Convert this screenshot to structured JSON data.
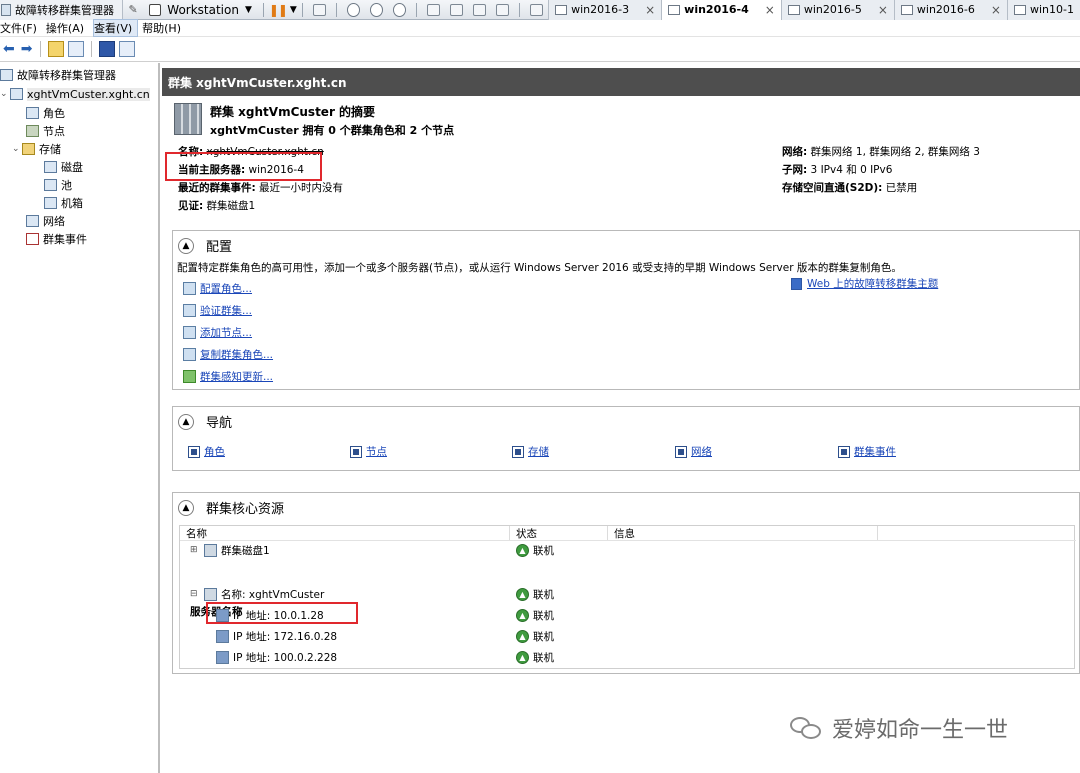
{
  "vmware": {
    "app_title": "故障转移群集管理器",
    "product": "Workstation",
    "tabs": [
      {
        "label": "win2016-3",
        "active": false
      },
      {
        "label": "win2016-4",
        "active": true
      },
      {
        "label": "win2016-5",
        "active": false
      },
      {
        "label": "win2016-6",
        "active": false
      },
      {
        "label": "win10-1",
        "active": false
      }
    ],
    "close_glyph": "×"
  },
  "menu": {
    "file": "文件(F)",
    "action": "操作(A)",
    "view": "查看(V)",
    "help": "帮助(H)"
  },
  "tree": {
    "root": "故障转移群集管理器",
    "cluster": "xghtVmCuster.xght.cn",
    "roles": "角色",
    "nodes": "节点",
    "storage": "存储",
    "disks": "磁盘",
    "pools": "池",
    "enclosures": "机箱",
    "networks": "网络",
    "events": "群集事件"
  },
  "main": {
    "header": "群集 xghtVmCuster.xght.cn",
    "summary_title": "群集 xghtVmCuster 的摘要",
    "summary_sub": "xghtVmCuster 拥有 0 个群集角色和 2 个节点",
    "name_label": "名称:",
    "name_value": "xghtVmCuster.xght.cn",
    "host_label": "当前主服务器:",
    "host_value": "win2016-4",
    "events_label": "最近的群集事件:",
    "events_value": "最近一小时内没有",
    "witness_label": "见证:",
    "witness_value": "群集磁盘1",
    "network_label": "网络:",
    "network_value": "群集网络 1, 群集网络 2, 群集网络 3",
    "subnet_label": "子网:",
    "subnet_value": "3 IPv4 和 0 IPv6",
    "s2d_label": "存储空间直通(S2D):",
    "s2d_value": "已禁用"
  },
  "config": {
    "title": "配置",
    "description": "配置特定群集角色的高可用性，添加一个或多个服务器(节点)，或从运行 Windows Server 2016 或受支持的早期 Windows Server 版本的群集复制角色。",
    "links": [
      "配置角色...",
      "验证群集...",
      "添加节点...",
      "复制群集角色...",
      "群集感知更新..."
    ],
    "web_link": "Web 上的故障转移群集主题"
  },
  "navigation": {
    "title": "导航",
    "links": [
      "角色",
      "节点",
      "存储",
      "网络",
      "群集事件"
    ]
  },
  "core": {
    "title": "群集核心资源",
    "columns": [
      "名称",
      "状态",
      "信息"
    ],
    "disk_row": "群集磁盘1",
    "group_label": "服务器名称",
    "server_name": "名称: xghtVmCuster",
    "ip_rows": [
      "IP 地址: 10.0.1.28",
      "IP 地址: 172.16.0.28",
      "IP 地址: 100.0.2.228"
    ],
    "status_online": "联机"
  },
  "watermark": "爱婷如命一生一世",
  "colors": {
    "highlight_box": "#e0282d",
    "header_bg": "#4e4e4e",
    "link": "#1a46b8",
    "online_green": "#3f9b3f"
  }
}
